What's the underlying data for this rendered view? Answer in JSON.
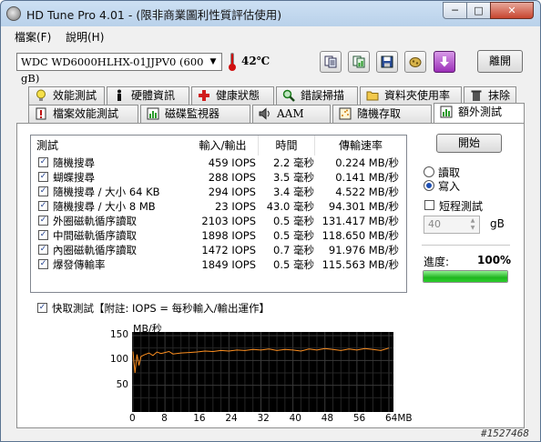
{
  "window": {
    "title": "HD Tune Pro 4.01 - (限非商業圖利性質評估使用)"
  },
  "caption_buttons": {
    "minimize": "─",
    "maximize": "□",
    "close": "✕"
  },
  "menu": {
    "items": [
      "檔案(F)",
      "說明(H)"
    ]
  },
  "toolbar": {
    "drive": "WDC WD6000HLHX-01JJPV0 (600 gB)",
    "temperature": "42℃",
    "buttons": [
      "copy-text-icon",
      "copy-screenshot-icon",
      "save-icon",
      "options-icon",
      "download-icon"
    ],
    "exit_label": "離開"
  },
  "tabs_row1": [
    "效能測試",
    "硬體資訊",
    "健康狀態",
    "錯誤掃描",
    "資料夾使用率",
    "抹除"
  ],
  "tabs_row2": [
    "檔案效能測試",
    "磁碟監視器",
    "AAM",
    "隨機存取",
    "額外測試"
  ],
  "active_tab": "額外測試",
  "results": {
    "headers": [
      "測試",
      "輸入/輸出",
      "時間",
      "傳輸速率"
    ],
    "rows": [
      {
        "name": "隨機搜尋",
        "io": "459 IOPS",
        "time": "2.2 毫秒",
        "rate": "0.224 MB/秒",
        "checked": true
      },
      {
        "name": "蝴蝶搜尋",
        "io": "288 IOPS",
        "time": "3.5 毫秒",
        "rate": "0.141 MB/秒",
        "checked": true
      },
      {
        "name": "隨機搜尋 / 大小 64 KB",
        "io": "294 IOPS",
        "time": "3.4 毫秒",
        "rate": "4.522 MB/秒",
        "checked": true
      },
      {
        "name": "隨機搜尋 / 大小 8 MB",
        "io": "23 IOPS",
        "time": "43.0 毫秒",
        "rate": "94.301 MB/秒",
        "checked": true
      },
      {
        "name": "外圈磁軌循序讀取",
        "io": "2103 IOPS",
        "time": "0.5 毫秒",
        "rate": "131.417 MB/秒",
        "checked": true
      },
      {
        "name": "中間磁軌循序讀取",
        "io": "1898 IOPS",
        "time": "0.5 毫秒",
        "rate": "118.650 MB/秒",
        "checked": true
      },
      {
        "name": "內圈磁軌循序讀取",
        "io": "1472 IOPS",
        "time": "0.7 毫秒",
        "rate": "91.976 MB/秒",
        "checked": true
      },
      {
        "name": "爆發傳輸率",
        "io": "1849 IOPS",
        "time": "0.5 毫秒",
        "rate": "115.563 MB/秒",
        "checked": true
      }
    ]
  },
  "controls": {
    "start_label": "開始",
    "read_label": "讀取",
    "write_label": "寫入",
    "mode": "write",
    "short_test_label": "短程測試",
    "short_test_checked": false,
    "short_test_value": "40",
    "unit_label": "gB",
    "progress_label": "進度:",
    "progress_value": "100%",
    "progress_fraction": 1.0
  },
  "quick_test": {
    "checked": true,
    "label": "快取測試【附註: IOPS = 每秒輸入/輸出運作】"
  },
  "watermark": "#1527468",
  "chart_data": {
    "type": "line",
    "title": "",
    "ylabel": "MB/秒",
    "xlabel": "",
    "ylim": [
      0,
      150
    ],
    "xlim": [
      0,
      64
    ],
    "y_ticks": [
      "150",
      "100",
      "50"
    ],
    "x_ticks": [
      "0",
      "8",
      "16",
      "24",
      "32",
      "40",
      "48",
      "56",
      "64MB"
    ],
    "grid": true,
    "series": [
      {
        "color": "#ff9020",
        "x": [
          0,
          0.5,
          1,
          1.5,
          2,
          3,
          4,
          5,
          6,
          7,
          8,
          9,
          10,
          12,
          14,
          16,
          18,
          20,
          22,
          24,
          26,
          28,
          30,
          32,
          34,
          36,
          38,
          40,
          42,
          44,
          46,
          48,
          50,
          52,
          54,
          56,
          58,
          60,
          62,
          64
        ],
        "y": [
          118,
          75,
          112,
          90,
          108,
          112,
          115,
          110,
          117,
          114,
          116,
          118,
          113,
          115,
          116,
          117,
          119,
          118,
          120,
          119,
          121,
          120,
          122,
          121,
          123,
          120,
          122,
          121,
          119,
          123,
          121,
          124,
          122,
          120,
          123,
          121,
          124,
          122,
          120,
          125
        ]
      }
    ]
  }
}
